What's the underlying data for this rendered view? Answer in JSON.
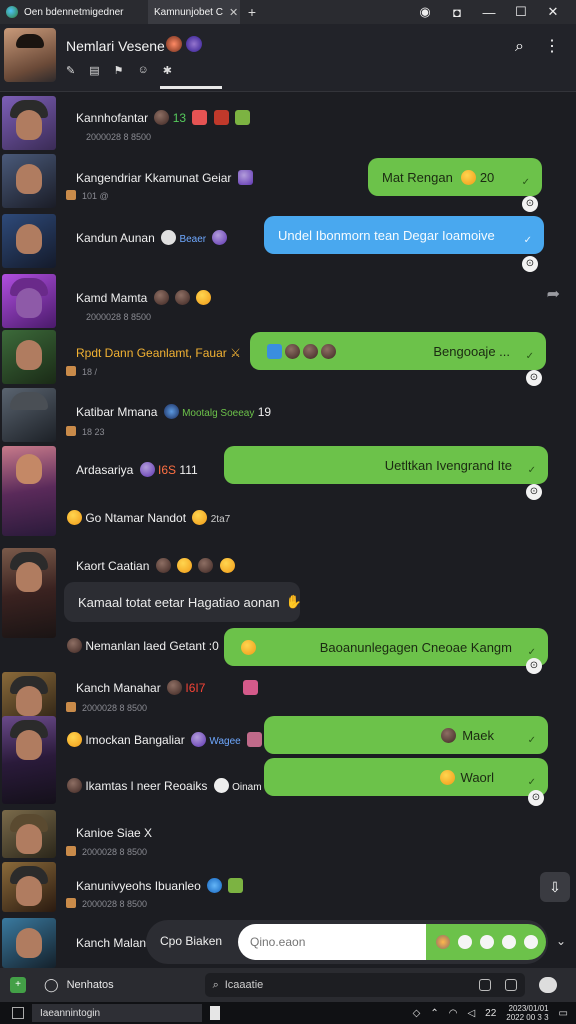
{
  "browser": {
    "tabs": [
      {
        "title": "Oen bdennetmigedner"
      },
      {
        "title": "Kamnunjobet C"
      }
    ],
    "new_tab": "+"
  },
  "header": {
    "title": "Nemlari Vesene",
    "search_icon": "search-icon",
    "more_icon": "more-icon"
  },
  "messages": [
    {
      "name": "Kannhofantar",
      "badge": "13",
      "time": "2000028 8 8500"
    },
    {
      "name": "Kangendriar Kkamunat Geiar",
      "time": "101 @",
      "bubble": "Mat Rengan",
      "bubble_extra": "20"
    },
    {
      "name": "Kandun Aunan",
      "badge": "Beaer",
      "bubble": "Undel Ibonmorn tean Degar Ioamoive"
    },
    {
      "name": "Kamd Mamta",
      "time": "2000028 8 8500"
    },
    {
      "name": "Rpdt Dann Geanlamt, Fauar",
      "time": "18 /",
      "bubble": "Bengooaje ..."
    },
    {
      "name": "Katibar Mmana",
      "badge": "Mootalg Soeeay",
      "badge2": "19",
      "time": "18 23"
    },
    {
      "name": "Ardasariya",
      "badge": "I6S",
      "badge2": "111",
      "bubble": "Uetltkan Ivengrand Ite"
    },
    {
      "name": "Go Ntamar Nandot",
      "badge": "2ta7"
    },
    {
      "name": "Kaort Caatian"
    },
    {
      "name": "Kamaal totat eetar Hagatiao aonan"
    },
    {
      "name": "Nemanlan laed Getant :0",
      "bubble": "Baoanunlegagen Cneoae Kangm"
    },
    {
      "name": "Kanch Manahar",
      "badge": "I6I7",
      "time": "2000028 8 8500"
    },
    {
      "name": "Imockan Bangaliar",
      "badge": "Wagee",
      "bubble": "Maek"
    },
    {
      "name": "Ikamtas l neer Reoaiks",
      "badge": "Oinam",
      "bubble": "Waorl"
    },
    {
      "name": "Kanioe Siae X",
      "time": "2000028 8 8500"
    },
    {
      "name": "Kanunivyeohs Ibuanleo",
      "time": "2000028 8 8500"
    },
    {
      "name": "Kanch Malan"
    }
  ],
  "compose": {
    "label": "Cpo Biaken",
    "placeholder": "Qino.eaon"
  },
  "bottom_bar": {
    "name": "Nenhatos",
    "search": "Icaaatie"
  },
  "taskbar": {
    "app": "Iaeannintogin",
    "clock_time": "2023/01/01",
    "clock_date": "2022 00 3 3",
    "tray_num": "22"
  },
  "colors": {
    "bubble_green": "#6cc24a",
    "bubble_blue": "#49a8ef",
    "background": "#1c1d22"
  }
}
